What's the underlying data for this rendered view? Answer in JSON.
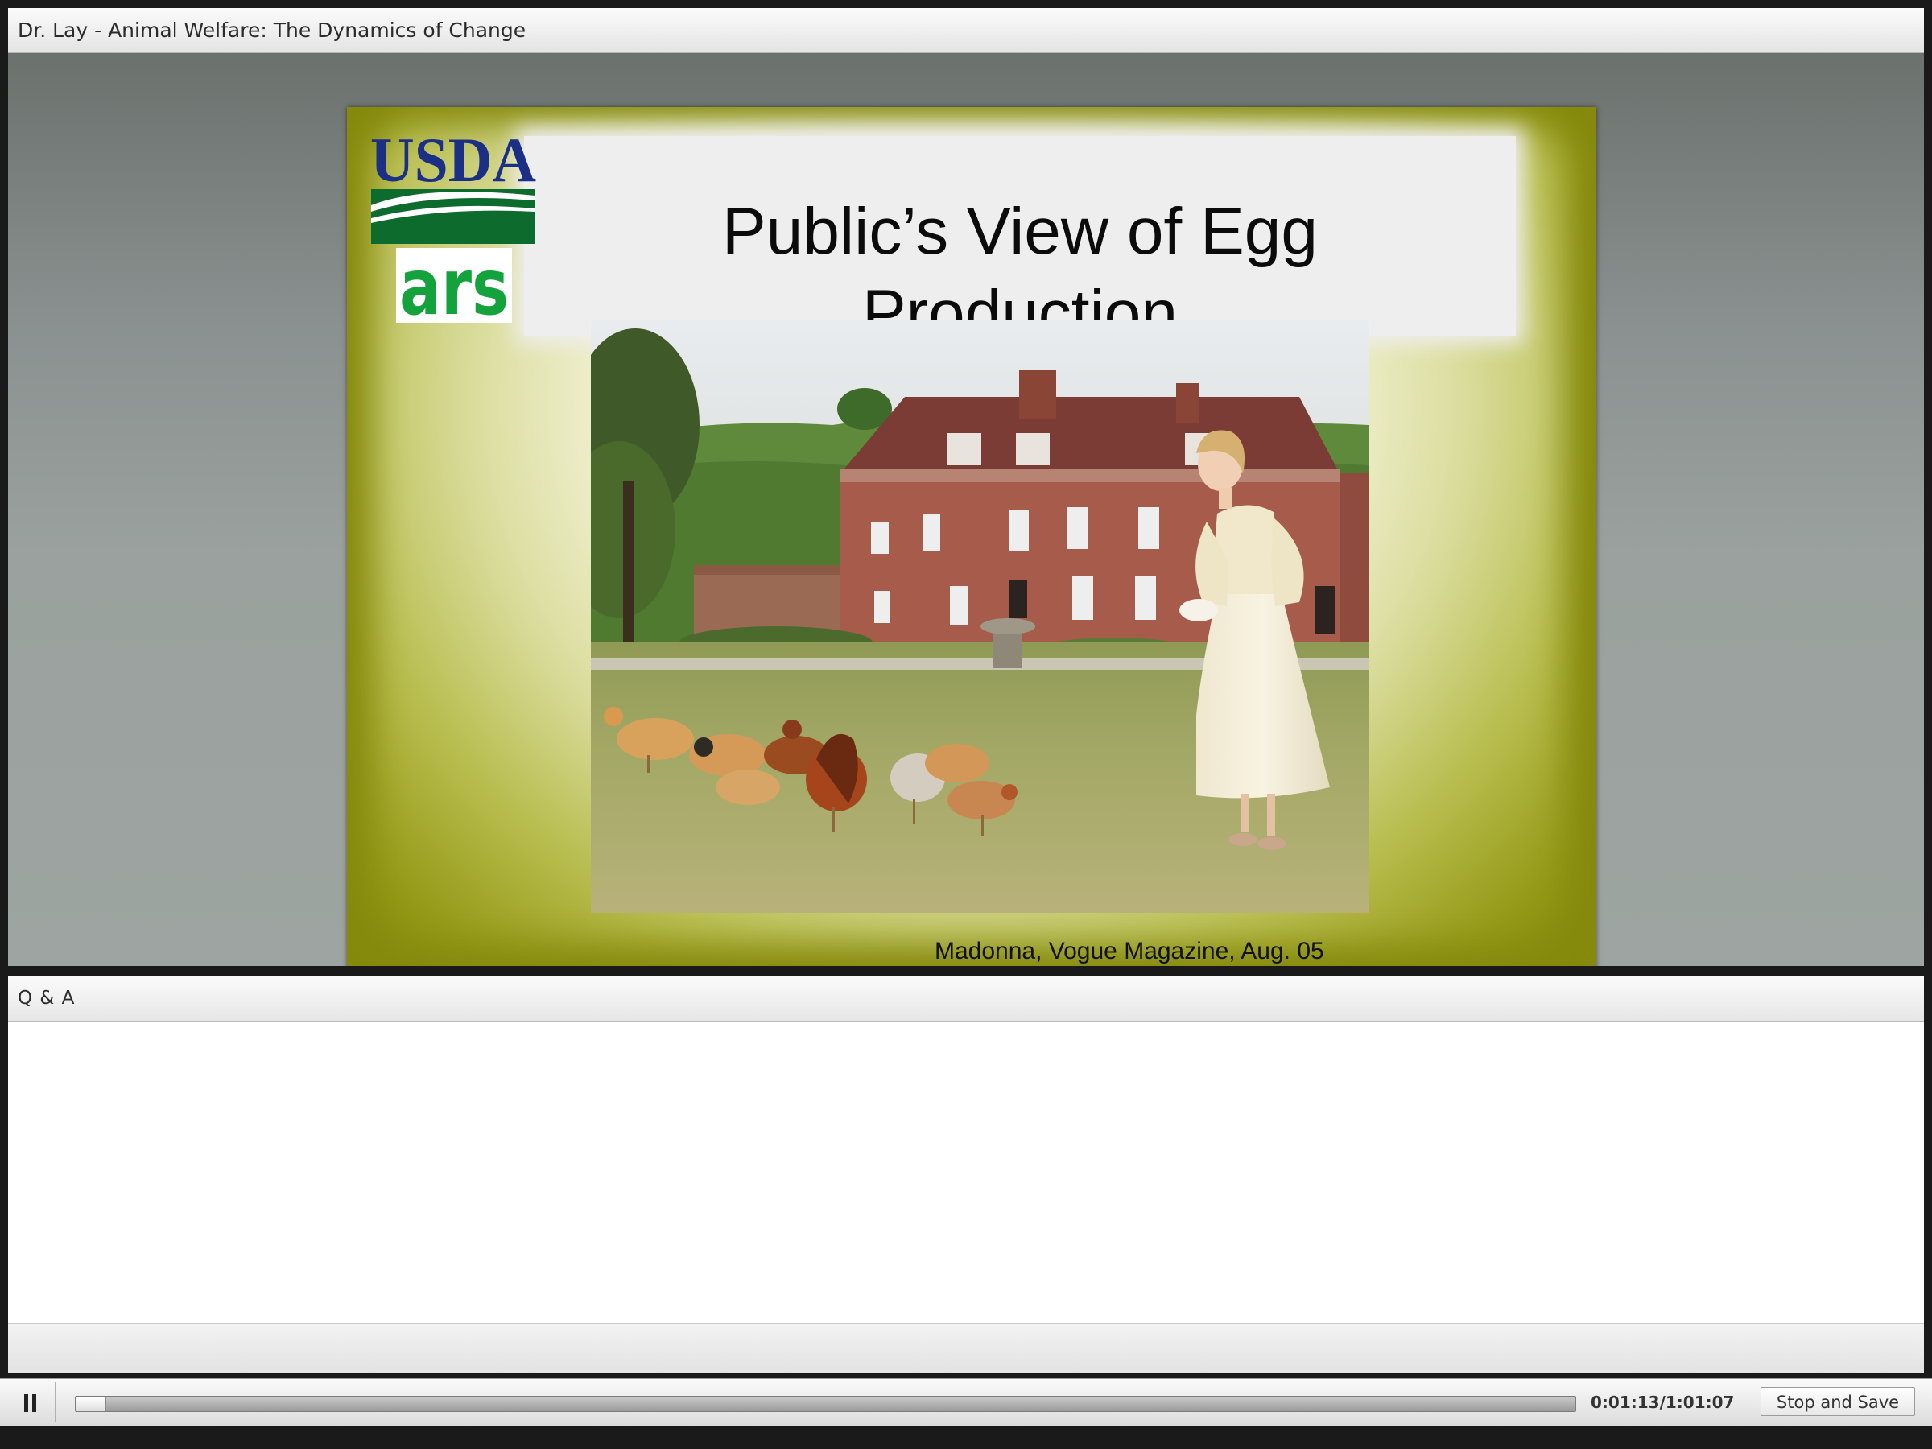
{
  "window": {
    "title": "Dr. Lay - Animal Welfare: The Dynamics of Change"
  },
  "slide": {
    "title_line1": "Public’s View of Egg",
    "title_line2": "Production",
    "logo_usda": "USDA",
    "logo_ars": "ars",
    "caption": "Madonna, Vogue Magazine, Aug. 05"
  },
  "qa": {
    "title": "Q & A"
  },
  "playback": {
    "state_icon": "pause-icon",
    "elapsed": "0:01:13",
    "total": "1:01:07",
    "time_readout": "0:01:13/1:01:07",
    "progress_fraction": 0.0199,
    "stop_save_label": "Stop and Save"
  },
  "colors": {
    "usda_blue": "#1b2f86",
    "usda_green": "#0d6b2e",
    "ars_green": "#13a23b",
    "slide_olive": "#858a0c"
  }
}
